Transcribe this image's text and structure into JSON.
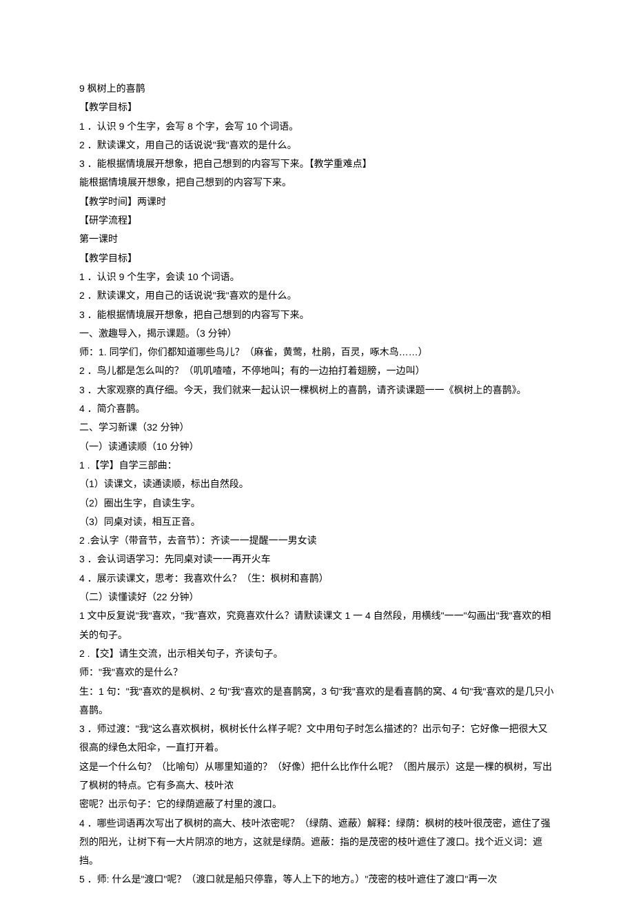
{
  "lines": [
    "9 枫树上的喜鹊",
    "【教学目标】",
    "1 ．认识 9 个生字，会写 8 个字，会写 10 个词语。",
    "2 ．默读课文，用自己的话说说\"我\"喜欢的是什么。",
    "3 ．能根据情境展开想象，把自己想到的内容写下来。【教学重难点】",
    "能根据情境展开想象，把自己想到的内容写下来。",
    "【教学时间】两课时",
    "【研学流程】",
    "第一课时",
    "【教学目标】",
    "1 ．认识 9 个生字，会读 10 个词语。",
    "2 ．默读课文，用自己的话说说\"我\"喜欢的是什么。",
    "3 ．能根据情境展开想象，把自己想到的内容写下来。",
    "一、激趣导入，揭示课题。（3 分钟）",
    "师：1. 同学们，你们都知道哪些鸟儿？（麻雀，黄莺，杜鹃，百灵，啄木鸟……）",
    "2 ．鸟儿都是怎么叫的？（叽叽喳喳，不停地叫；有的一边拍打着翅膀，一边叫）",
    "3 ．大家观察的真仔细。今天，我们就来一起认识一棵枫树上的喜鹊，请齐读课题一一《枫树上的喜鹊》。",
    "4 ．简介喜鹊。",
    "二、学习新课（32 分钟）",
    "（一）读通读顺（10 分钟）",
    "1 .【学】自学三部曲：",
    "（1）读课文，读通读顺，标出自然段。",
    "（2）圈出生字，自读生字。",
    "（3）同桌对读，相互正音。",
    "2 .会认字（带音节，去音节）：齐读一一提醒一一男女读",
    "3 ．会认词语学习：先同桌对读一一再开火车",
    "4 ．展示读课文，思考：我喜欢什么？（生：枫树和喜鹊）",
    "（二）读懂读好（22 分钟）",
    "1 文中反复说\"我\"喜欢，\"我\"喜欢，究竟喜欢什么？请默读课文 1 一 4 自然段，用横线\"一一\"勾画出\"我\"喜欢的相关的句子。",
    "2 .【交】请生交流，出示相关句子，齐读句子。",
    "师：\"我\"喜欢的是什么？",
    "生：1 句：\"我\"喜欢的是枫树、2 句\"我\"喜欢的是喜鹊窝，3 句\"我\"喜欢的是看喜鹊的窝、4 句\"我\"喜欢的是几只小喜鹊。",
    "3 ．师过渡：\"我\"这么喜欢枫树，枫树长什么样子呢？文中用句子时怎么描述的？出示句子：它好像一把很大又很高的绿色太阳伞，一直打开着。",
    "这是一个什么句？（比喻句）从哪里知道的？（好像）把什么比作什么呢？（图片展示）这是一棵的枫树，写出了枫树的特点。它有多高大、枝叶浓",
    "密呢？出示句子：它的绿荫遮蔽了村里的渡口。",
    "4 ．哪些词语再次写出了枫树的高大、枝叶浓密呢？（绿荫、遮蔽）解释：绿荫：枫树的枝叶很茂密，遮住了强烈的阳光，让树下有一大片阴凉的地方，这就是绿荫。遮蔽：指的是茂密的枝叶遮住了渡口。找个近义词：遮挡。",
    "5 ．师: 什么是\"渡口\"呢？（渡口就是船只停靠，等人上下的地方。）\"茂密的枝叶遮住了渡口\"再一次"
  ]
}
